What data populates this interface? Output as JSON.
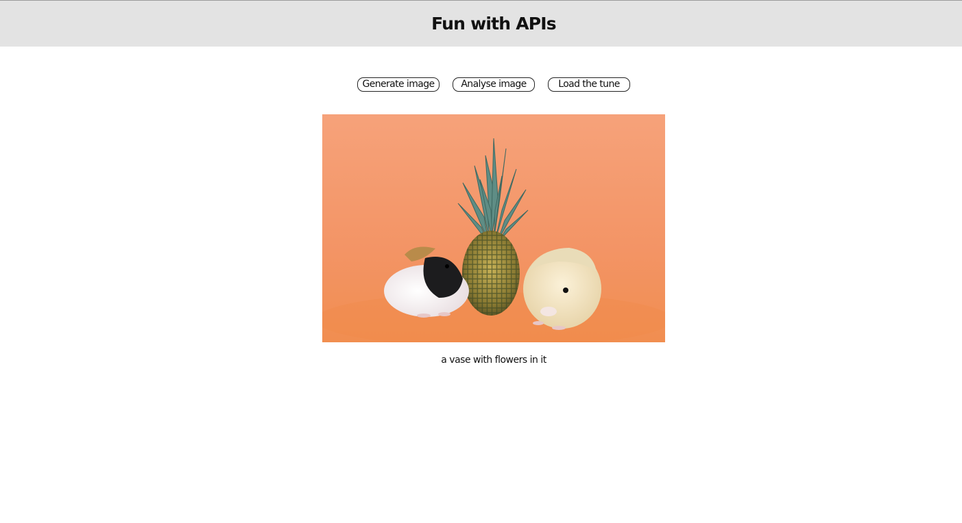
{
  "header": {
    "title": "Fun with APIs"
  },
  "toolbar": {
    "generate_label": "Generate image",
    "analyse_label": "Analyse image",
    "tune_label": "Load the tune"
  },
  "image": {
    "caption": "a vase with flowers in it",
    "background_color": "#f39a6c"
  },
  "colors": {
    "header_bg": "#e3e3e3",
    "page_bg": "#ffffff",
    "text": "#111111"
  }
}
